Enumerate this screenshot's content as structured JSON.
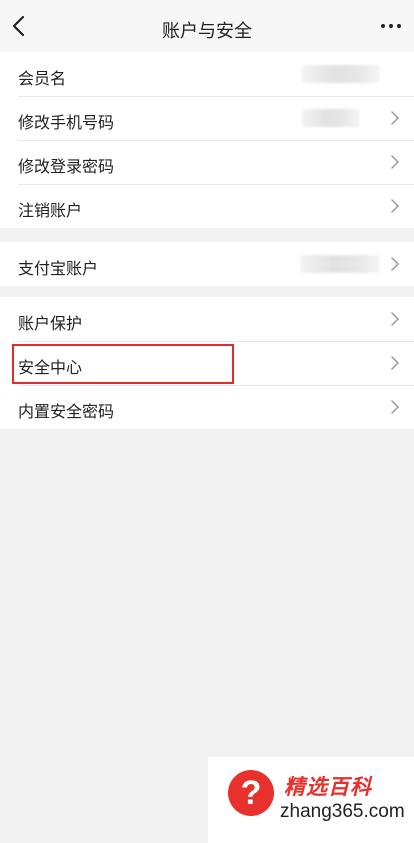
{
  "header": {
    "title": "账户与安全",
    "back_icon": "chevron-left-icon",
    "more_icon": "more-horizontal-icon"
  },
  "groups": [
    {
      "items": [
        {
          "label": "会员名",
          "value_masked": true,
          "chevron": false
        },
        {
          "label": "修改手机号码",
          "value_masked": true,
          "chevron": true
        },
        {
          "label": "修改登录密码",
          "value_masked": false,
          "chevron": true
        },
        {
          "label": "注销账户",
          "value_masked": false,
          "chevron": true
        }
      ]
    },
    {
      "items": [
        {
          "label": "支付宝账户",
          "value_masked": true,
          "chevron": true
        }
      ]
    },
    {
      "items": [
        {
          "label": "账户保护",
          "chevron": true
        },
        {
          "label": "安全中心",
          "chevron": true,
          "highlighted": true
        },
        {
          "label": "内置安全密码",
          "chevron": true
        }
      ]
    }
  ],
  "annotation": {
    "highlight_color": "#e02e2e",
    "highlight_target": "安全中心"
  },
  "watermark": {
    "badge": "?",
    "title": "精选百科",
    "url": "zhang365.com",
    "color": "#e8302c"
  }
}
